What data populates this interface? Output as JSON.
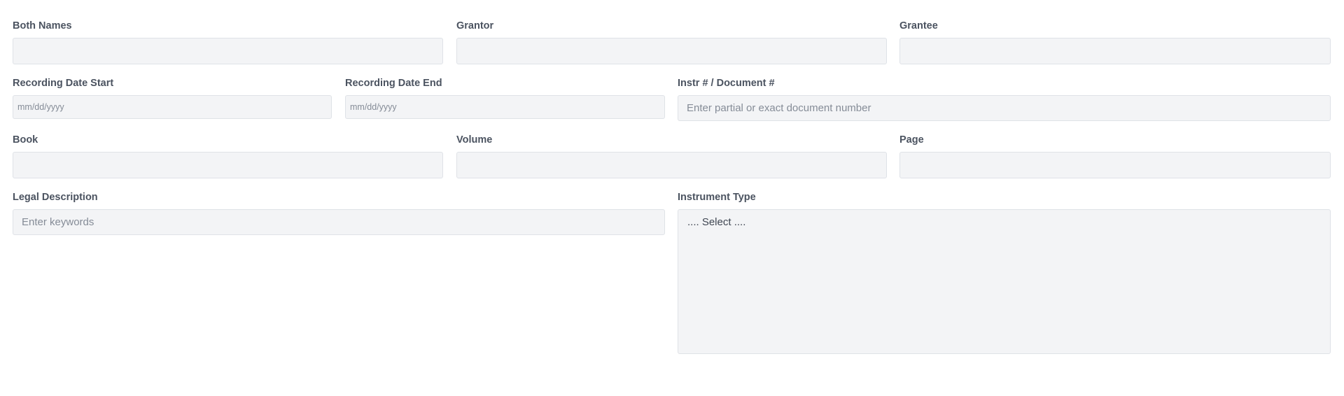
{
  "search_form": {
    "both_names": {
      "label": "Both Names",
      "value": "",
      "placeholder": ""
    },
    "grantor": {
      "label": "Grantor",
      "value": "",
      "placeholder": ""
    },
    "grantee": {
      "label": "Grantee",
      "value": "",
      "placeholder": ""
    },
    "recording_date_start": {
      "label": "Recording Date Start",
      "placeholder": "mm/dd/yyyy"
    },
    "recording_date_end": {
      "label": "Recording Date End",
      "placeholder": "mm/dd/yyyy"
    },
    "document_number": {
      "label": "Instr # / Document #",
      "placeholder": "Enter partial or exact document number"
    },
    "book": {
      "label": "Book",
      "value": "",
      "placeholder": ""
    },
    "volume": {
      "label": "Volume",
      "value": "",
      "placeholder": ""
    },
    "page": {
      "label": "Page",
      "value": "",
      "placeholder": ""
    },
    "legal_description": {
      "label": "Legal Description",
      "placeholder": "Enter keywords"
    },
    "instrument_type": {
      "label": "Instrument Type",
      "selected": ".... Select ...."
    }
  }
}
